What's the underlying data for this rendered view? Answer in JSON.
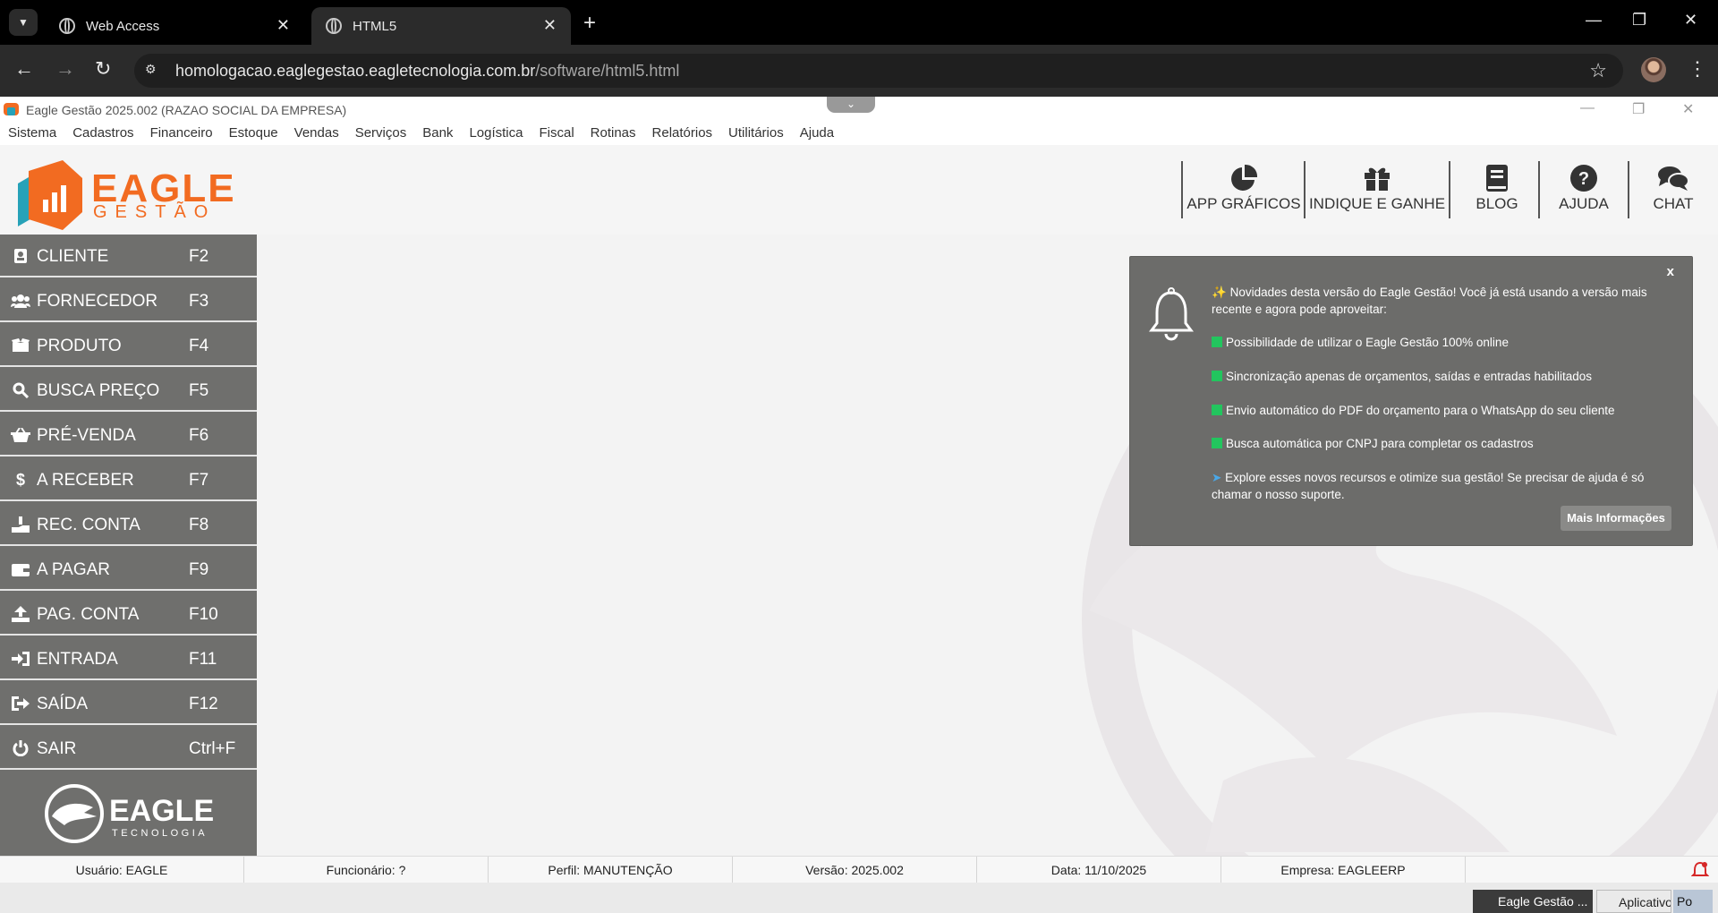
{
  "browser": {
    "tabs": [
      {
        "title": "Web Access"
      },
      {
        "title": "HTML5"
      }
    ],
    "url_host": "homologacao.eaglegestao.eagletecnologia.com.br",
    "url_path": "/software/html5.html"
  },
  "app": {
    "window_title": "Eagle Gestão 2025.002 (RAZAO SOCIAL DA EMPRESA)",
    "menu": [
      "Sistema",
      "Cadastros",
      "Financeiro",
      "Estoque",
      "Vendas",
      "Serviços",
      "Bank",
      "Logística",
      "Fiscal",
      "Rotinas",
      "Relatórios",
      "Utilitários",
      "Ajuda"
    ],
    "brand": {
      "word": "EAGLE",
      "sub": "GESTÃO"
    },
    "header_buttons": [
      {
        "label": "APP GRÁFICOS",
        "icon": "pie-chart-icon"
      },
      {
        "label": "INDIQUE E GANHE",
        "icon": "gift-icon"
      },
      {
        "label": "BLOG",
        "icon": "book-icon"
      },
      {
        "label": "AJUDA",
        "icon": "question-icon"
      },
      {
        "label": "CHAT",
        "icon": "chat-icon"
      }
    ]
  },
  "sidebar": {
    "items": [
      {
        "label": "CLIENTE",
        "key": "F2",
        "icon": "contact-card-icon"
      },
      {
        "label": "FORNECEDOR",
        "key": "F3",
        "icon": "users-icon"
      },
      {
        "label": "PRODUTO",
        "key": "F4",
        "icon": "box-icon"
      },
      {
        "label": "BUSCA PREÇO",
        "key": "F5",
        "icon": "search-icon"
      },
      {
        "label": "PRÉ-VENDA",
        "key": "F6",
        "icon": "basket-icon"
      },
      {
        "label": "A RECEBER",
        "key": "F7",
        "icon": "dollar-icon"
      },
      {
        "label": "REC. CONTA",
        "key": "F8",
        "icon": "hand-coin-icon"
      },
      {
        "label": "A PAGAR",
        "key": "F9",
        "icon": "wallet-icon"
      },
      {
        "label": "PAG. CONTA",
        "key": "F10",
        "icon": "upload-icon"
      },
      {
        "label": "ENTRADA",
        "key": "F11",
        "icon": "sign-in-icon"
      },
      {
        "label": "SAÍDA",
        "key": "F12",
        "icon": "sign-out-icon"
      },
      {
        "label": "SAIR",
        "key": "Ctrl+F",
        "icon": "power-icon"
      }
    ],
    "footer_brand": {
      "word": "EAGLE",
      "sub": "TECNOLOGIA"
    }
  },
  "notification": {
    "close": "x",
    "intro": "Novidades desta versão do Eagle Gestão! Você já está usando a versão mais recente e agora pode aproveitar:",
    "features": [
      "Possibilidade de utilizar o Eagle Gestão 100% online",
      "Sincronização apenas de orçamentos, saídas e entradas habilitados",
      "Envio automático do PDF do orçamento para o WhatsApp do seu cliente",
      "Busca automática por CNPJ para completar os cadastros"
    ],
    "outro": "Explore esses novos recursos e otimize sua gestão! Se precisar de ajuda é só chamar o nosso suporte.",
    "button": "Mais Informações",
    "feature_color": "#22c55e"
  },
  "status": {
    "usuario": "Usuário: EAGLE",
    "funcionario": "Funcionário: ?",
    "perfil": "Perfil: MANUTENÇÃO",
    "versao": "Versão: 2025.002",
    "data": "Data: 11/10/2025",
    "empresa": "Empresa: EAGLEERP"
  },
  "taskbar": [
    "Eagle Gestão ...",
    "Aplicativo",
    "Po"
  ],
  "colors": {
    "brand_orange": "#f26b21",
    "brand_teal": "#27a2b8",
    "sidebar": "#6f6f6d",
    "notification": "#6c6c6a"
  }
}
